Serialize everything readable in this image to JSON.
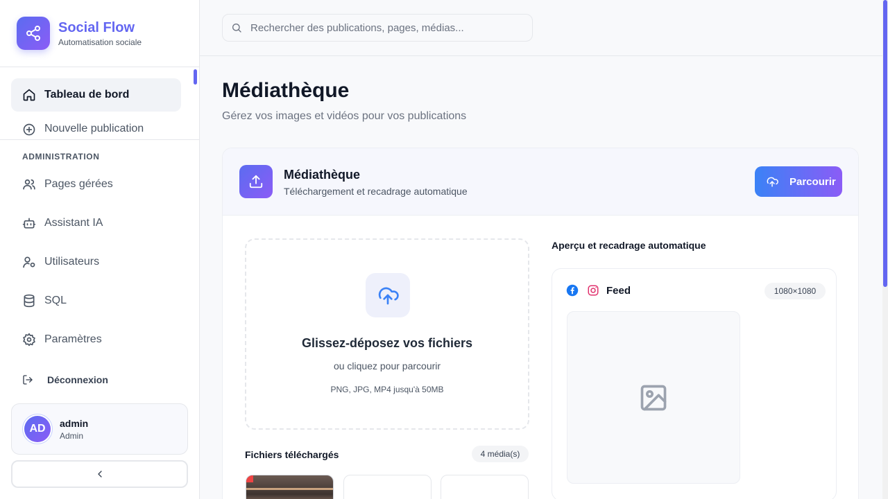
{
  "brand": {
    "name": "Social Flow",
    "subtitle": "Automatisation sociale"
  },
  "sidebar": {
    "nav": [
      {
        "label": "Tableau de bord",
        "icon": "home-icon",
        "active": true
      },
      {
        "label": "Nouvelle publication",
        "icon": "plus-circle-icon",
        "active": false
      }
    ],
    "section_title": "ADMINISTRATION",
    "admin_items": [
      {
        "label": "Pages gérées",
        "icon": "users-icon"
      },
      {
        "label": "Assistant IA",
        "icon": "bot-icon"
      },
      {
        "label": "Utilisateurs",
        "icon": "user-cog-icon"
      },
      {
        "label": "SQL",
        "icon": "database-icon"
      },
      {
        "label": "Paramètres",
        "icon": "settings-icon"
      }
    ],
    "logout_label": "Déconnexion",
    "user": {
      "initials": "AD",
      "name": "admin",
      "role": "Admin"
    }
  },
  "search": {
    "placeholder": "Rechercher des publications, pages, médias...",
    "value": ""
  },
  "page": {
    "title": "Médiathèque",
    "subtitle": "Gérez vos images et vidéos pour vos publications"
  },
  "card": {
    "title": "Médiathèque",
    "subtitle": "Téléchargement et recadrage automatique",
    "browse_label": "Parcourir",
    "dropzone": {
      "title": "Glissez-déposez vos fichiers",
      "subtitle": "ou cliquez pour parcourir",
      "formats": "PNG, JPG, MP4 jusqu'à 50MB"
    },
    "files": {
      "title": "Fichiers téléchargés",
      "count": "4 média(s)"
    },
    "preview": {
      "title": "Aperçu et recadrage automatique",
      "format_label": "Feed",
      "size": "1080×1080"
    }
  },
  "colors": {
    "accent": "#6366f1",
    "accent_gradient_start": "#3b82f6",
    "accent_gradient_end": "#8b5cf6",
    "facebook": "#1877f2",
    "instagram": "#e1306c"
  }
}
